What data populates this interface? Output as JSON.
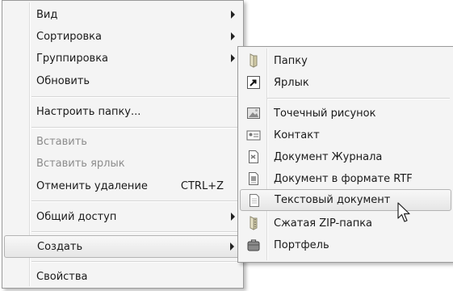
{
  "context_menu": {
    "items": [
      {
        "label": "Вид"
      },
      {
        "label": "Сортировка"
      },
      {
        "label": "Группировка"
      },
      {
        "label": "Обновить"
      },
      {
        "label": "Настроить папку..."
      },
      {
        "label": "Вставить",
        "state": "disabled"
      },
      {
        "label": "Вставить ярлык",
        "state": "disabled"
      },
      {
        "label": "Отменить удаление",
        "shortcut": "CTRL+Z"
      },
      {
        "label": "Общий доступ"
      },
      {
        "label": "Создать",
        "state": "highlighted"
      },
      {
        "label": "Свойства"
      }
    ]
  },
  "submenu_create": {
    "items": [
      {
        "label": "Папку",
        "icon": "folder-icon"
      },
      {
        "label": "Ярлык",
        "icon": "shortcut-icon"
      },
      {
        "label": "Точечный рисунок",
        "icon": "bitmap-image-icon"
      },
      {
        "label": "Контакт",
        "icon": "contact-card-icon"
      },
      {
        "label": "Документ Журнала",
        "icon": "journal-document-icon"
      },
      {
        "label": "Документ в формате RTF",
        "icon": "rtf-document-icon"
      },
      {
        "label": "Текстовый документ",
        "icon": "text-document-icon",
        "state": "highlighted"
      },
      {
        "label": "Сжатая ZIP-папка",
        "icon": "zip-folder-icon"
      },
      {
        "label": "Портфель",
        "icon": "briefcase-icon"
      }
    ]
  },
  "colors": {
    "menu_background": "#f4f4f4",
    "disabled_text": "#8c8c8c",
    "highlight_border": "#b4b4b4"
  }
}
